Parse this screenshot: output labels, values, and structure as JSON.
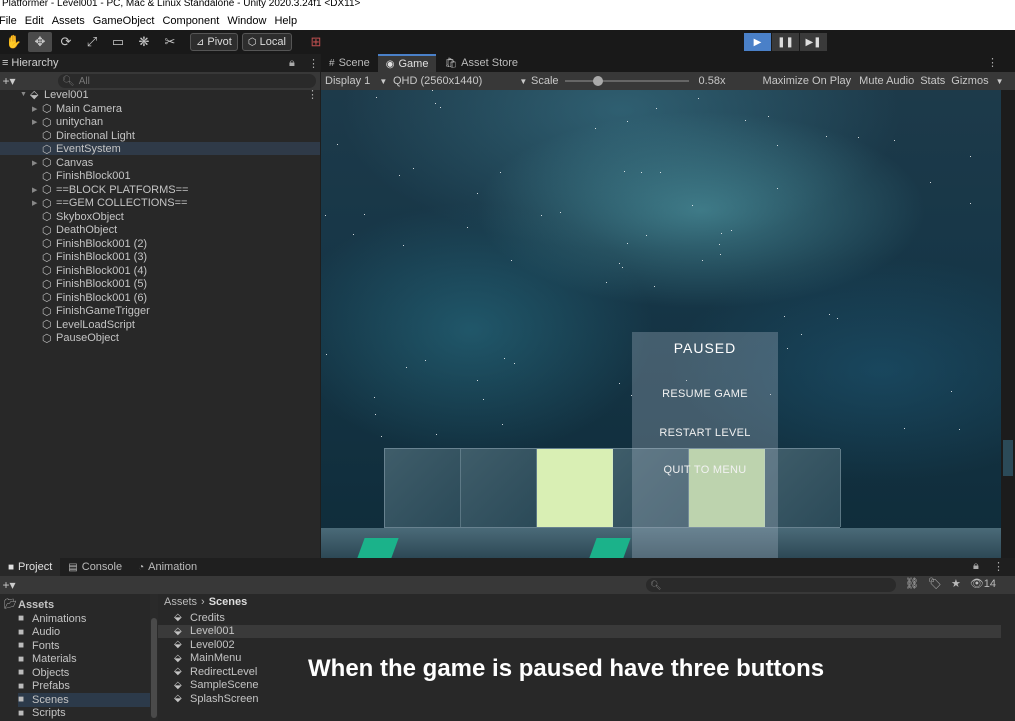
{
  "window": {
    "title": "Platformer - Level001 - PC, Mac & Linux Standalone - Unity 2020.3.24f1 <DX11>"
  },
  "menu": [
    "File",
    "Edit",
    "Assets",
    "GameObject",
    "Component",
    "Window",
    "Help"
  ],
  "toolbar": {
    "pivot_label": "Pivot",
    "local_label": "Local"
  },
  "hierarchy": {
    "tab_label": "Hierarchy",
    "search_placeholder": "All",
    "root": "Level001",
    "items": [
      "Main Camera",
      "unitychan",
      "Directional Light",
      "EventSystem",
      "Canvas",
      "FinishBlock001",
      "==BLOCK PLATFORMS==",
      "==GEM COLLECTIONS==",
      "SkyboxObject",
      "DeathObject",
      "FinishBlock001 (2)",
      "FinishBlock001 (3)",
      "FinishBlock001 (4)",
      "FinishBlock001 (5)",
      "FinishBlock001 (6)",
      "FinishGameTrigger",
      "LevelLoadScript",
      "PauseObject"
    ],
    "expandable": [
      true,
      true,
      false,
      false,
      true,
      false,
      true,
      true,
      false,
      false,
      false,
      false,
      false,
      false,
      false,
      false,
      false,
      false
    ]
  },
  "game_view": {
    "tabs": [
      "Scene",
      "Game",
      "Asset Store"
    ],
    "display": "Display 1",
    "resolution": "QHD (2560x1440)",
    "scale_label": "Scale",
    "scale_value": "0.58x",
    "maximize_label": "Maximize On Play",
    "mute_label": "Mute Audio",
    "stats_label": "Stats",
    "gizmos_label": "Gizmos",
    "pause_menu": {
      "title": "PAUSED",
      "resume": "RESUME GAME",
      "restart": "RESTART LEVEL",
      "quit": "QUIT TO MENU"
    }
  },
  "project": {
    "tabs": [
      "Project",
      "Console",
      "Animation"
    ],
    "hidden_count": "14",
    "folders_root": "Assets",
    "folders": [
      "Animations",
      "Audio",
      "Fonts",
      "Materials",
      "Objects",
      "Prefabs",
      "Scenes",
      "Scripts"
    ],
    "breadcrumb_root": "Assets",
    "breadcrumb_current": "Scenes",
    "files": [
      "Credits",
      "Level001",
      "Level002",
      "MainMenu",
      "RedirectLevel",
      "SampleScene",
      "SplashScreen"
    ]
  },
  "caption": "When the game is paused have three buttons"
}
